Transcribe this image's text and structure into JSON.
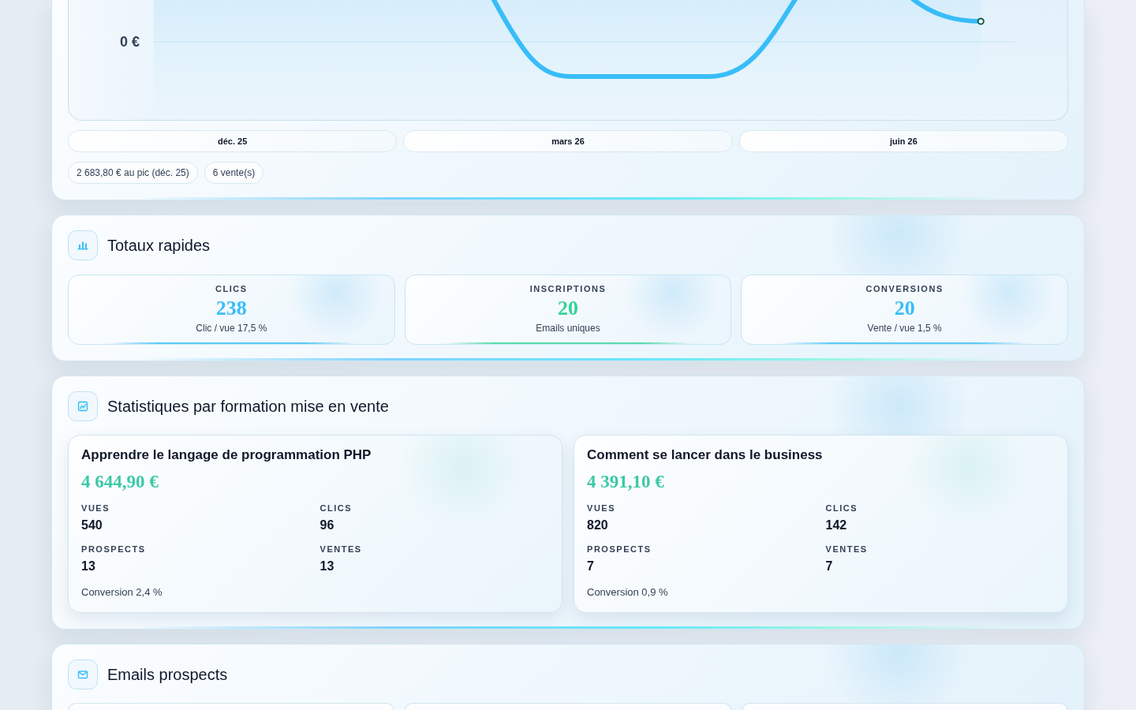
{
  "revenue_chart": {
    "y_tick_label": "0 €",
    "periods": [
      "déc. 25",
      "mars 26",
      "juin 26"
    ],
    "badges": [
      "2 683,80 € au pic (déc. 25)",
      "6 vente(s)"
    ]
  },
  "quick_totals": {
    "title": "Totaux rapides",
    "tiles": [
      {
        "label": "CLICS",
        "value": "238",
        "detail": "Clic / vue 17,5 %",
        "color": "#38bdf8"
      },
      {
        "label": "INSCRIPTIONS",
        "value": "20",
        "detail": "Emails uniques",
        "color": "#34d399"
      },
      {
        "label": "CONVERSIONS",
        "value": "20",
        "detail": "Vente / vue 1,5 %",
        "color": "#38bdf8"
      }
    ]
  },
  "course_stats": {
    "title": "Statistiques par formation mise en vente",
    "courses": [
      {
        "name": "Apprendre le langage de programmation PHP",
        "revenue": "4 644,90 €",
        "metrics": [
          {
            "label": "VUES",
            "value": "540"
          },
          {
            "label": "CLICS",
            "value": "96"
          },
          {
            "label": "PROSPECTS",
            "value": "13"
          },
          {
            "label": "VENTES",
            "value": "13"
          }
        ],
        "conversion": "Conversion 2,4 %"
      },
      {
        "name": "Comment se lancer dans le business",
        "revenue": "4 391,10 €",
        "metrics": [
          {
            "label": "VUES",
            "value": "820"
          },
          {
            "label": "CLICS",
            "value": "142"
          },
          {
            "label": "PROSPECTS",
            "value": "7"
          },
          {
            "label": "VENTES",
            "value": "7"
          }
        ],
        "conversion": "Conversion 0,9 %"
      }
    ]
  },
  "prospect_emails": {
    "title": "Emails prospects"
  }
}
